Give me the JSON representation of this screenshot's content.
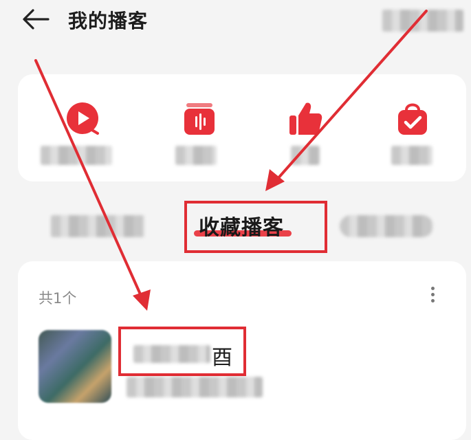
{
  "header": {
    "title": "我的播客",
    "back_icon": "arrow-left-icon"
  },
  "quick_actions": [
    {
      "icon": "play-circle-icon",
      "color": "#e8313a"
    },
    {
      "icon": "podcast-box-icon",
      "color": "#e8313a"
    },
    {
      "icon": "thumbs-up-icon",
      "color": "#e8313a"
    },
    {
      "icon": "shopping-bag-check-icon",
      "color": "#e8313a"
    }
  ],
  "tabs": {
    "active_label": "收藏播客"
  },
  "list": {
    "count_label": "共1个",
    "items": [
      {
        "title_visible_end": "酉"
      }
    ]
  },
  "colors": {
    "accent": "#e8313a",
    "annotation": "#e02d34",
    "background": "#f4f4f4"
  }
}
